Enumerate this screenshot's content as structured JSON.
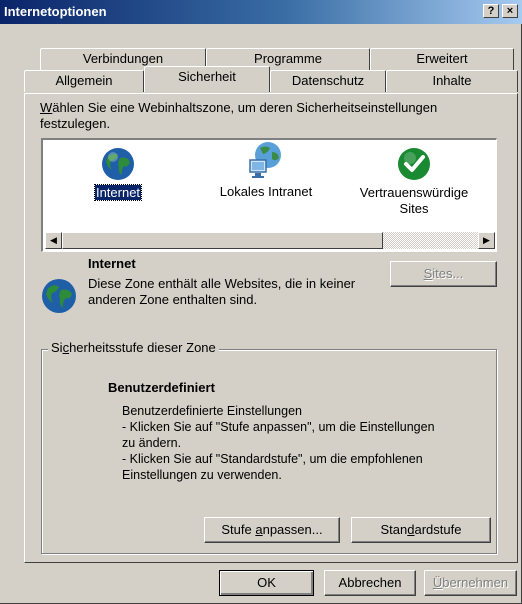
{
  "window": {
    "title": "Internetoptionen",
    "help_button": "?",
    "close_button": "×"
  },
  "tabs": {
    "row1": [
      "Verbindungen",
      "Programme",
      "Erweitert"
    ],
    "row2": [
      "Allgemein",
      "Sicherheit",
      "Datenschutz",
      "Inhalte"
    ],
    "active": "Sicherheit"
  },
  "zones": {
    "instruction_line1_prefix": "W",
    "instruction_line1_rest": "ählen Sie eine Webinhaltszone, um deren Sicherheitseinstellungen",
    "instruction_line2": "festzulegen.",
    "items": [
      {
        "label": "Internet",
        "icon": "globe-icon",
        "selected": true
      },
      {
        "label": "Lokales Intranet",
        "icon": "intranet-icon",
        "selected": false
      },
      {
        "label_line1": "Vertrauenswürdige",
        "label_line2": "Sites",
        "icon": "checkmark-icon",
        "selected": false
      }
    ],
    "scroll_left": "◀",
    "scroll_right": "▶"
  },
  "selected_zone": {
    "name": "Internet",
    "desc_line1": "Diese Zone enthält alle Websites, die in keiner",
    "desc_line2": "anderen Zone enthalten sind.",
    "sites_button_prefix": "S",
    "sites_button_rest": "ites..."
  },
  "security_level": {
    "legend_prefix": "Si",
    "legend_underlined": "c",
    "legend_rest": "herheitsstufe dieser Zone",
    "heading": "Benutzerdefiniert",
    "line1": "Benutzerdefinierte Einstellungen",
    "line2": "- Klicken Sie auf \"Stufe anpassen\", um die Einstellungen",
    "line3": "zu ändern.",
    "line4": "- Klicken Sie auf \"Standardstufe\", um die empfohlenen",
    "line5": "Einstellungen zu verwenden.",
    "custom_button_prefix": "Stufe ",
    "custom_button_underlined": "a",
    "custom_button_rest": "npassen...",
    "default_button_prefix": "Stan",
    "default_button_underlined": "d",
    "default_button_rest": "ardstufe"
  },
  "footer": {
    "ok": "OK",
    "cancel": "Abbrechen",
    "apply_underlined": "Ü",
    "apply_rest": "bernehmen"
  }
}
